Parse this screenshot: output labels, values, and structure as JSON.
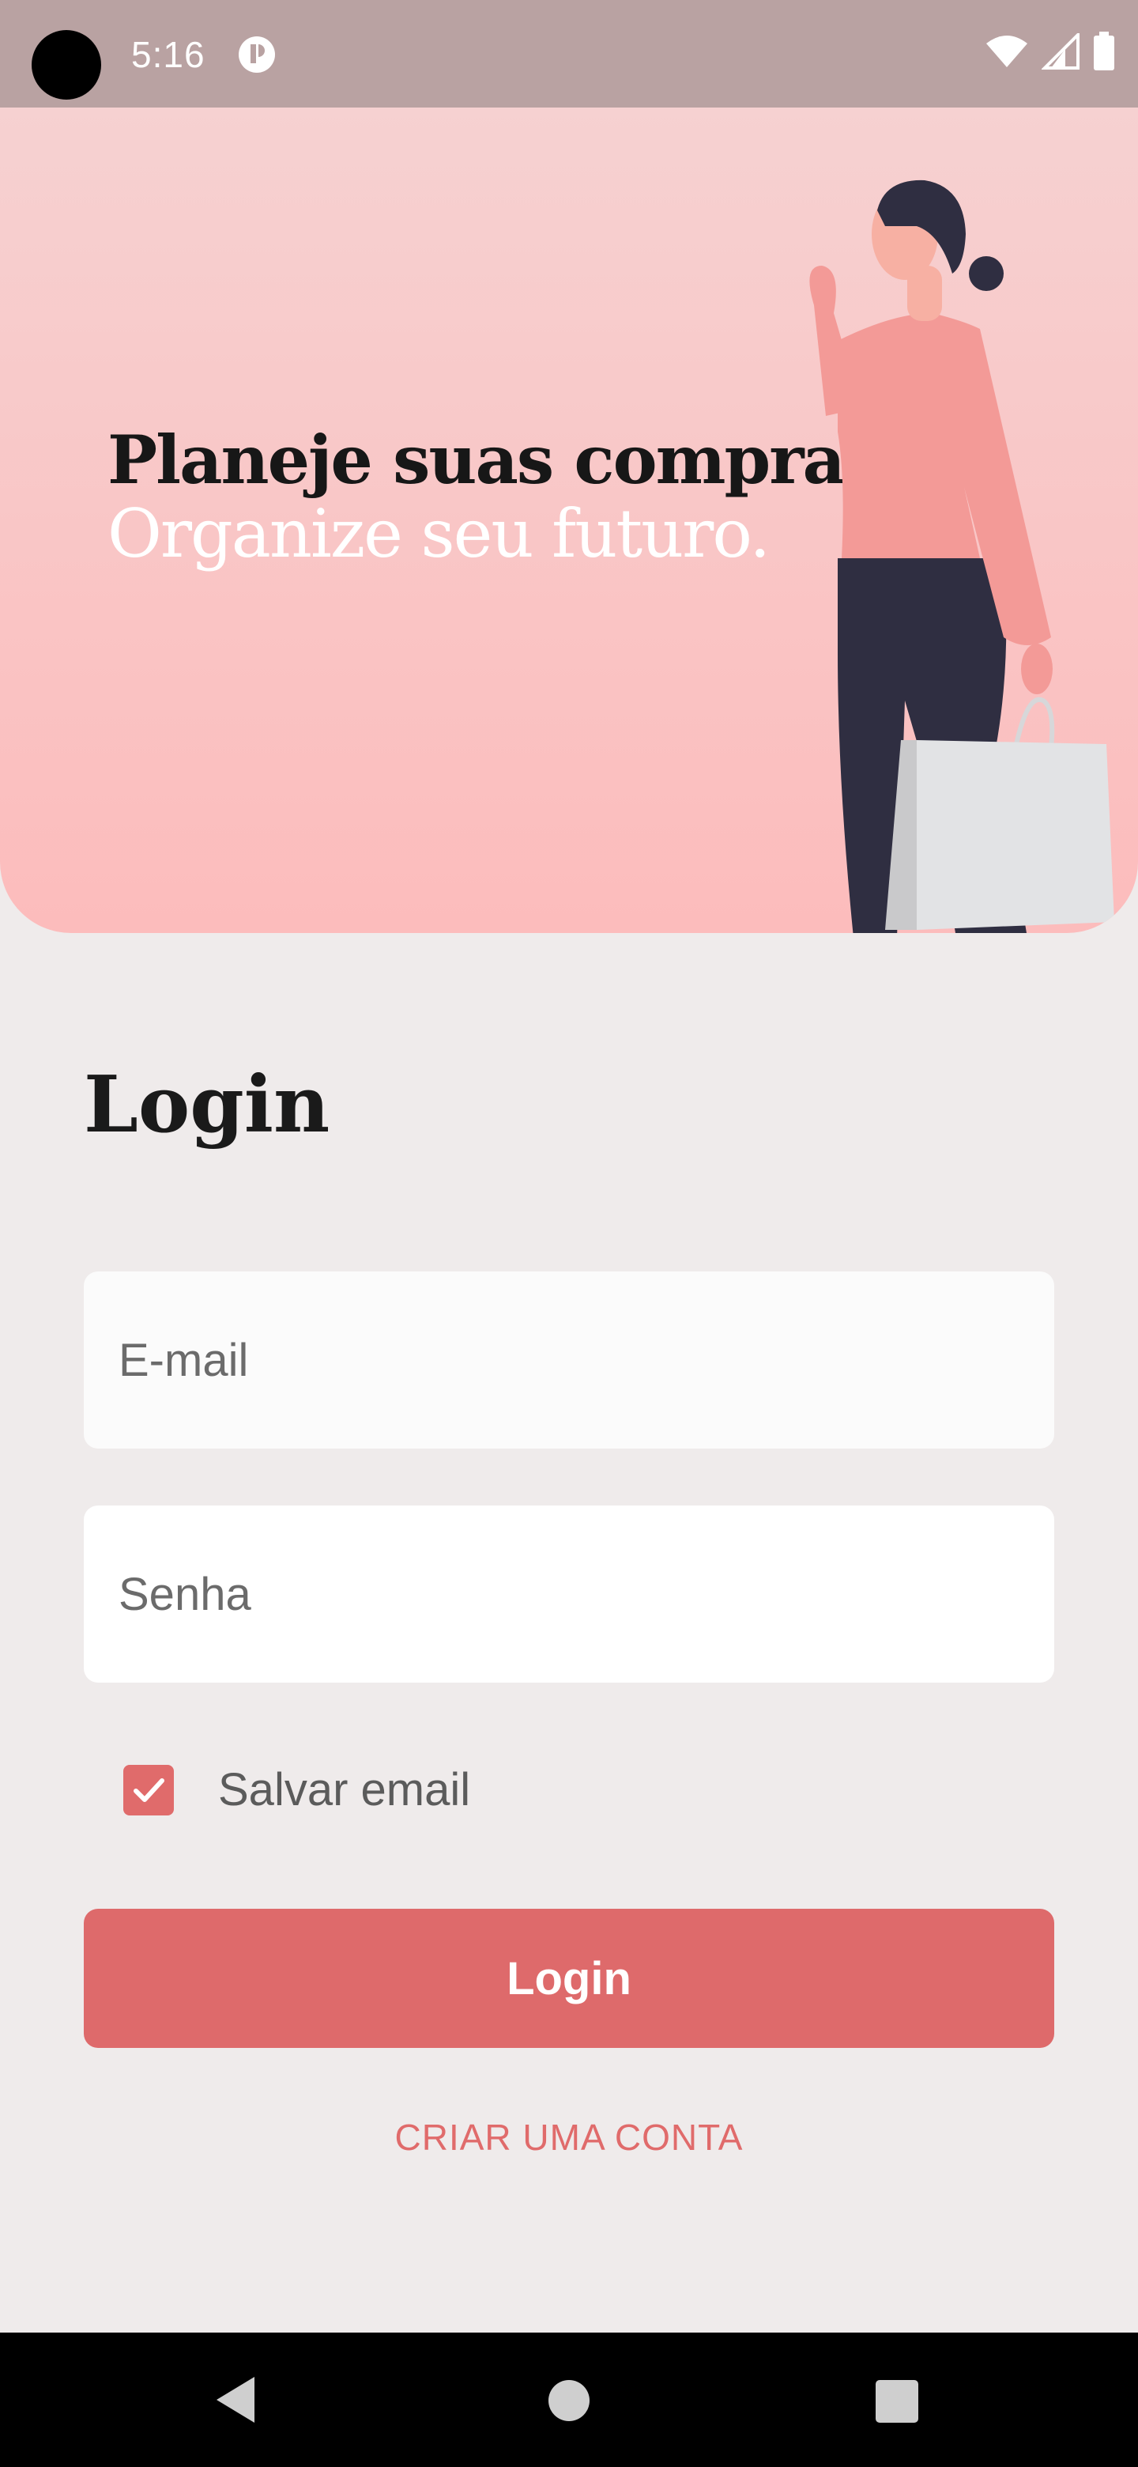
{
  "status_bar": {
    "time": "5:16",
    "icons": [
      "app-notification-icon",
      "wifi-icon",
      "signal-icon",
      "battery-icon"
    ]
  },
  "hero": {
    "title_line1": "Planeje suas compras.",
    "title_line2": "Organize seu futuro."
  },
  "login": {
    "heading": "Login",
    "email_placeholder": "E-mail",
    "password_placeholder": "Senha",
    "remember_label": "Salvar email",
    "remember_checked": true,
    "button_label": "Login",
    "create_account": "CRIAR UMA CONTA"
  },
  "colors": {
    "accent": "#de6a6b",
    "hero_top": "#f6d1d1",
    "hero_bottom": "#fcbcbc",
    "background": "#efebeb",
    "status_bar": "#b9a2a2"
  },
  "nav_bar": {
    "buttons": [
      "back-icon",
      "home-icon",
      "recents-icon"
    ]
  }
}
